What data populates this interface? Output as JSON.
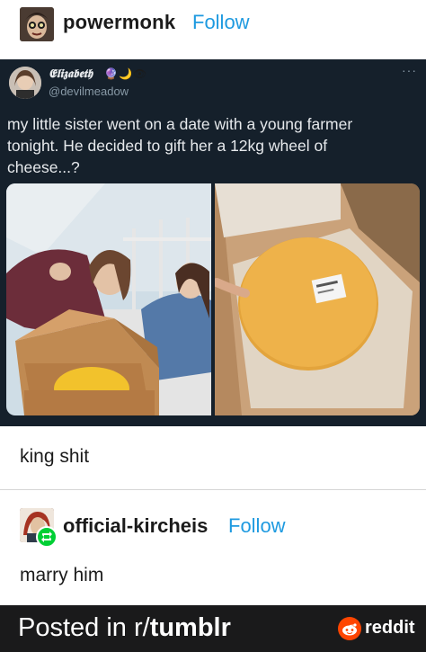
{
  "post": {
    "username": "powermonk",
    "follow_label": "Follow"
  },
  "tweet": {
    "display_name": "𝕰𝖑𝖎𝖟𝖆𝖇𝖊𝖙𝖍",
    "emojis": [
      "🔮",
      "🌙",
      "👁"
    ],
    "handle": "@devilmeadow",
    "more_label": "···",
    "text": "my little sister went on a date with a young farmer tonight. He decided to gift her a 12kg wheel of cheese...?"
  },
  "comment1": {
    "text": "king shit"
  },
  "reblog": {
    "username": "official-kircheis",
    "follow_label": "Follow",
    "text": "marry him"
  },
  "footer": {
    "prefix": "Posted in r/",
    "subreddit": "tumblr",
    "brand": "reddit"
  }
}
